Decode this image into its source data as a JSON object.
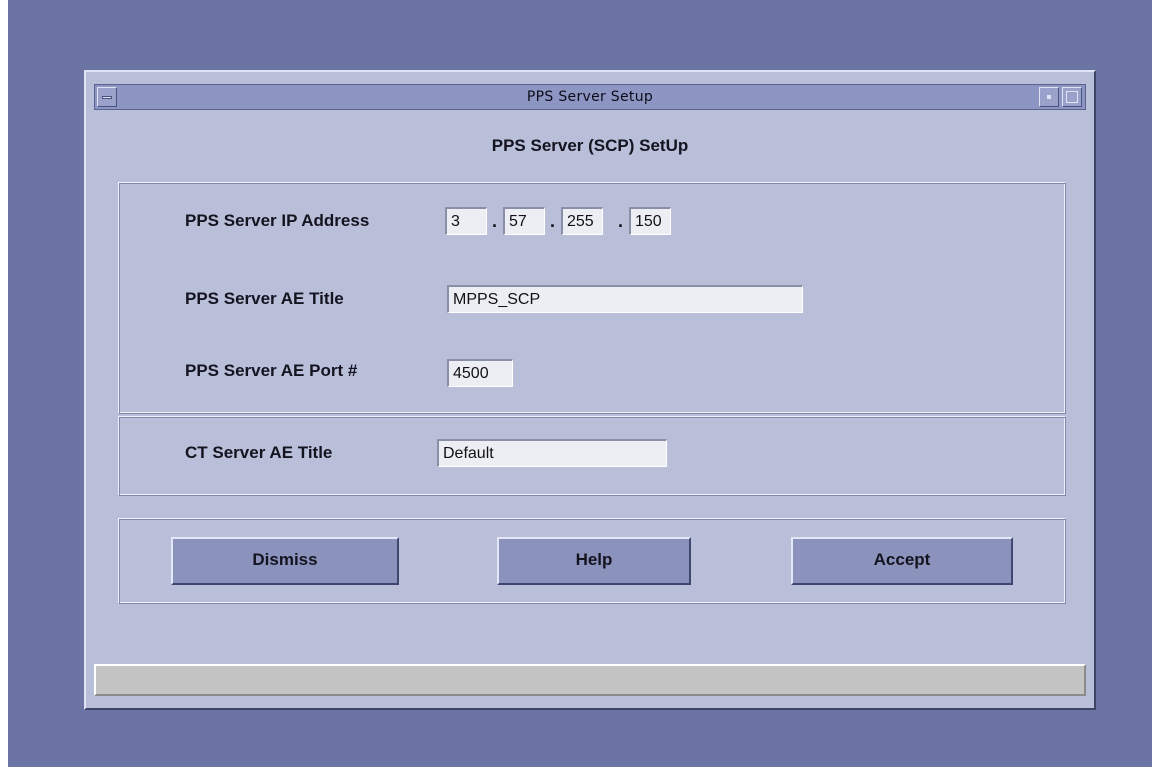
{
  "window": {
    "title": "PPS Server Setup"
  },
  "heading": "PPS Server (SCP) SetUp",
  "pps": {
    "ip_label": "PPS Server IP Address",
    "ip": [
      "3",
      "57",
      "255",
      "150"
    ],
    "ip_separator": ".",
    "ae_title_label": "PPS Server AE Title",
    "ae_title": "MPPS_SCP",
    "ae_port_label": "PPS Server AE Port #",
    "ae_port": "4500"
  },
  "ct": {
    "ae_title_label": "CT Server AE Title",
    "ae_title": "Default"
  },
  "buttons": {
    "dismiss": "Dismiss",
    "help": "Help",
    "accept": "Accept"
  },
  "status": ""
}
